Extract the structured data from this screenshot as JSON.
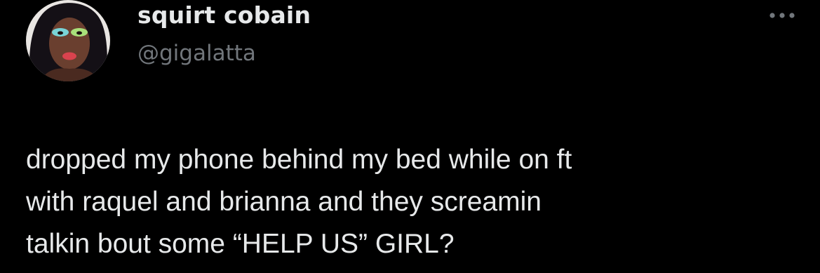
{
  "tweet": {
    "author": {
      "display_name": "squirt cobain",
      "handle": "@gigalatta"
    },
    "text_lines": [
      "dropped my phone behind my bed while on ft",
      "with raquel and brianna and they screamin",
      "talkin bout some “HELP US” GIRL?"
    ],
    "more_icon": "more-horizontal-icon",
    "colors": {
      "background": "#000000",
      "primary_text": "#e7e9ea",
      "secondary_text": "#71767b"
    }
  }
}
